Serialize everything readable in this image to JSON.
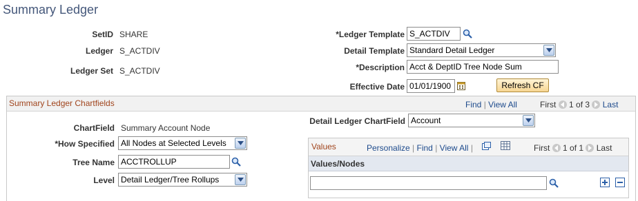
{
  "page": {
    "title": "Summary Ledger"
  },
  "header_left": {
    "setid_label": "SetID",
    "setid_value": "SHARE",
    "ledger_label": "Ledger",
    "ledger_value": "S_ACTDIV",
    "ledger_set_label": "Ledger Set",
    "ledger_set_value": "S_ACTDIV"
  },
  "header_right": {
    "ledger_template_label": "*Ledger Template",
    "ledger_template_value": "S_ACTDIV",
    "detail_template_label": "Detail Template",
    "detail_template_value": "Standard Detail Ledger",
    "description_label": "*Description",
    "description_value": "Acct & DeptID Tree Node Sum",
    "effective_date_label": "Effective Date",
    "effective_date_value": "01/01/1900",
    "refresh_button": "Refresh CF"
  },
  "chartfields_section": {
    "title": "Summary Ledger Chartfields",
    "nav": {
      "find": "Find",
      "sep": "|",
      "view_all": "View All",
      "first": "First",
      "count": "1 of 3",
      "last": "Last"
    },
    "chartfield_label": "ChartField",
    "chartfield_value": "Summary Account Node",
    "detail_ledger_cf_label": "Detail Ledger ChartField",
    "detail_ledger_cf_value": "Account",
    "how_specified_label": "*How Specified",
    "how_specified_value": "All Nodes at Selected Levels",
    "tree_name_label": "Tree Name",
    "tree_name_value": "ACCTROLLUP",
    "level_label": "Level",
    "level_value": "Detail Ledger/Tree Rollups"
  },
  "values_grid": {
    "title": "Values",
    "personalize": "Personalize",
    "find": "Find",
    "sep": "|",
    "view_all": "View All",
    "first": "First",
    "count": "1 of 1",
    "last": "Last",
    "column_header": "Values/Nodes",
    "row_value": ""
  },
  "colors": {
    "title": "#44577a",
    "section_title": "#a0441c",
    "link": "#1d4a8c",
    "button": "#f7d693"
  }
}
